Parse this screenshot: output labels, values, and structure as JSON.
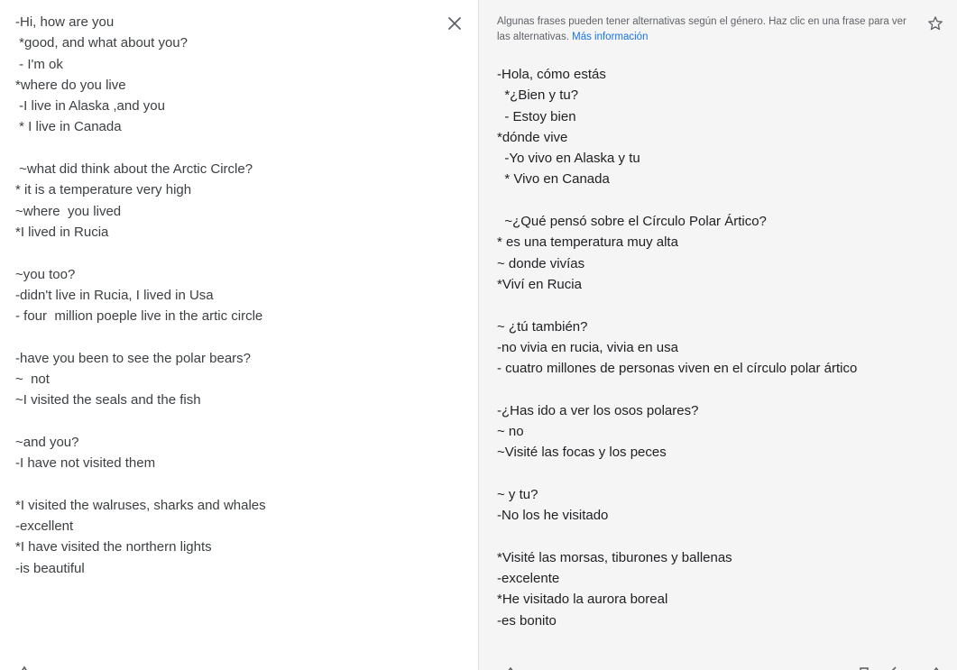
{
  "source": {
    "lines": [
      "-Hi, how are you",
      " *good, and what about you?",
      " - I'm ok",
      "*where do you live",
      " -I live in Alaska ,and you",
      " * I live in Canada",
      "",
      " ~what did think about the Arctic Circle?",
      "* it is a temperature very high",
      "~where  you lived",
      "*I lived in Rucia",
      "",
      "~you too?",
      "-didn't live in Rucia, I lived in Usa",
      "- four  million poeple live in the artic circle",
      "",
      "-have you been to see the polar bears?",
      "~  not",
      "~I visited the seals and the fish",
      "",
      "~and you?",
      "-I have not visited them",
      "",
      "*I visited the walruses, sharks and whales",
      "-excellent",
      "*I have visited the northern lights",
      "-is beautiful"
    ],
    "clear_icon": "close-icon"
  },
  "translation": {
    "notice": "Algunas frases pueden tener alternativas según el género. Haz clic en una frase para ver las alternativas.",
    "more_info": "Más información",
    "star_icon": "star-outline-icon",
    "lines": [
      "-Hola, cómo estás",
      "  *¿Bien y tu?",
      "  - Estoy bien",
      "*dónde vive",
      "  -Yo vivo en Alaska y tu",
      "  * Vivo en Canada",
      "",
      "  ~¿Qué pensó sobre el Círculo Polar Ártico?",
      "* es una temperatura muy alta",
      "~ donde vivías",
      "*Viví en Rucia",
      "",
      "~ ¿tú también?",
      "-no vivia en rucia, vivia en usa",
      "- cuatro millones de personas viven en el círculo polar ártico",
      "",
      "-¿Has ido a ver los osos polares?",
      "~ no",
      "~Visité las focas y los peces",
      "",
      "~ y tu?",
      "-No los he visitado",
      "",
      "*Visité las morsas, tiburones y ballenas",
      "-excelente",
      "*He visitado la aurora boreal",
      "-es bonito"
    ]
  },
  "colors": {
    "source_text": "#3c4043",
    "target_text": "#202124",
    "target_bg": "#f5f5f5",
    "link": "#1a73e8",
    "muted": "#5f6368"
  }
}
